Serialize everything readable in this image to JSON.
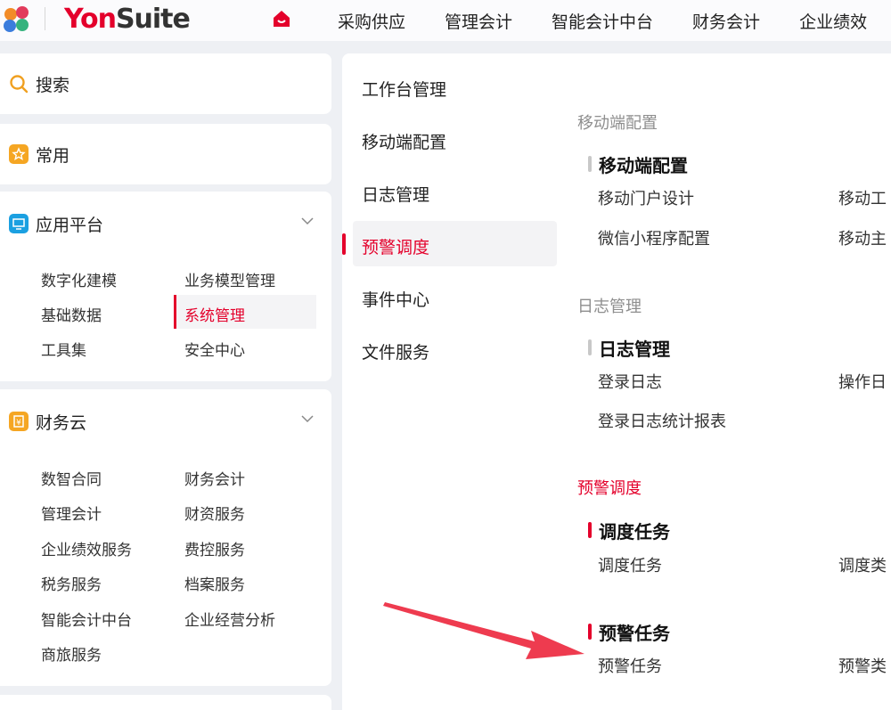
{
  "header": {
    "brand_part1": "Yon",
    "brand_part2": "Suite",
    "nav": [
      "采购供应",
      "管理会计",
      "智能会计中台",
      "财务会计",
      "企业绩效"
    ]
  },
  "sidebar": {
    "search_label": "搜索",
    "common_label": "常用",
    "platform": {
      "label": "应用平台",
      "items": [
        "数字化建模",
        "业务模型管理",
        "基础数据",
        "系统管理",
        "工具集",
        "安全中心"
      ]
    },
    "finance": {
      "label": "财务云",
      "items": [
        "数智合同",
        "财务会计",
        "管理会计",
        "财资服务",
        "企业绩效服务",
        "费控服务",
        "税务服务",
        "档案服务",
        "智能会计中台",
        "企业经营分析",
        "商旅服务"
      ]
    }
  },
  "middle": {
    "menu": [
      "工作台管理",
      "移动端配置",
      "日志管理",
      "预警调度",
      "事件中心",
      "文件服务"
    ],
    "sections": {
      "mobile": {
        "title": "移动端配置",
        "group": "移动端配置",
        "items": [
          "移动门户设计",
          "移动工",
          "微信小程序配置",
          "移动主"
        ]
      },
      "log": {
        "title": "日志管理",
        "group": "日志管理",
        "items": [
          "登录日志",
          "操作日",
          "登录日志统计报表"
        ]
      },
      "alert": {
        "title": "预警调度",
        "group1": "调度任务",
        "group1_items": [
          "调度任务",
          "调度类"
        ],
        "group2": "预警任务",
        "group2_items": [
          "预警任务",
          "预警类"
        ]
      }
    }
  },
  "colors": {
    "accent": "#e4002b",
    "background": "#eef0f4"
  }
}
